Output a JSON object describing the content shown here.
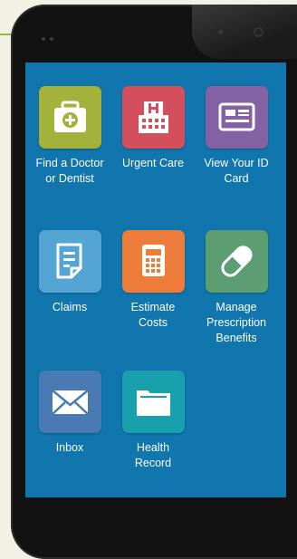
{
  "tiles": [
    {
      "label": "Find a Doctor\nor Dentist",
      "icon": "medical-kit-icon",
      "color": "#a2b23a"
    },
    {
      "label": "Urgent Care",
      "icon": "hospital-icon",
      "color": "#d34f5e"
    },
    {
      "label": "View Your ID\nCard",
      "icon": "id-card-icon",
      "color": "#8461a2"
    },
    {
      "label": "Claims",
      "icon": "document-icon",
      "color": "#54a4d4"
    },
    {
      "label": "Estimate\nCosts",
      "icon": "calculator-icon",
      "color": "#ee7d3c"
    },
    {
      "label": "Manage\nPrescription\nBenefits",
      "icon": "pill-icon",
      "color": "#5c9e72"
    },
    {
      "label": "Inbox",
      "icon": "mail-icon",
      "color": "#4a7ab4"
    },
    {
      "label": "Health\nRecord",
      "icon": "folder-icon",
      "color": "#18a0ac"
    }
  ]
}
